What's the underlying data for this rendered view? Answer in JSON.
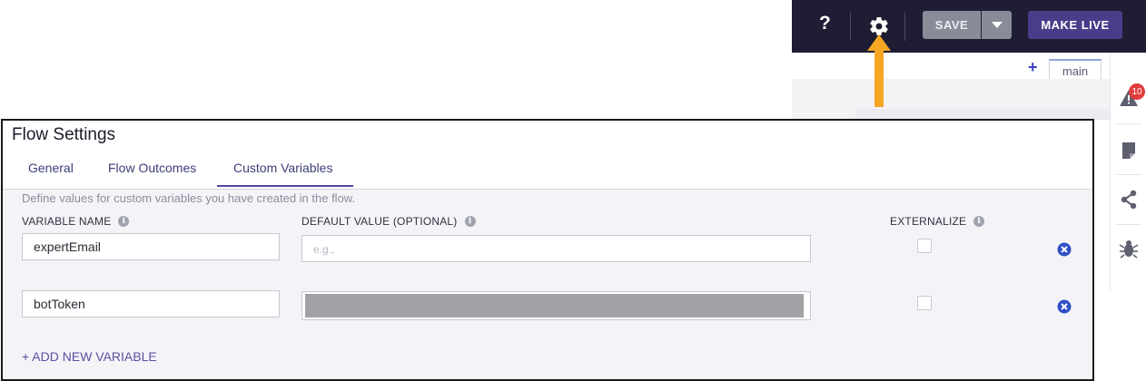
{
  "topbar": {
    "help_label": "?",
    "save_label": "SAVE",
    "make_live_label": "MAKE LIVE",
    "icons": [
      "help-icon",
      "gear-icon",
      "chevron-down-icon"
    ]
  },
  "canvas": {
    "add_tab_label": "+",
    "tab_label": "main",
    "highlight_color": "#f5a623"
  },
  "right_sidebar": {
    "warning_count": "10",
    "icons": [
      "warning-icon",
      "note-icon",
      "share-icon",
      "bug-icon"
    ]
  },
  "flow_settings": {
    "title": "Flow Settings",
    "tabs": [
      "General",
      "Flow Outcomes",
      "Custom Variables"
    ],
    "active_tab": "Custom Variables",
    "description": "Define values for custom variables you have created in the flow.",
    "columns": {
      "name": "VARIABLE NAME",
      "default": "DEFAULT VALUE (OPTIONAL)",
      "externalize": "EXTERNALIZE"
    },
    "variables": [
      {
        "name": "expertEmail",
        "default_placeholder": "e.g.,",
        "externalized": false
      },
      {
        "name": "botToken",
        "default_masked": true,
        "externalized": false
      }
    ],
    "add_label": "+ ADD NEW VARIABLE",
    "accent_color": "#4f4aa0",
    "remove_color": "#2f4fc4"
  }
}
